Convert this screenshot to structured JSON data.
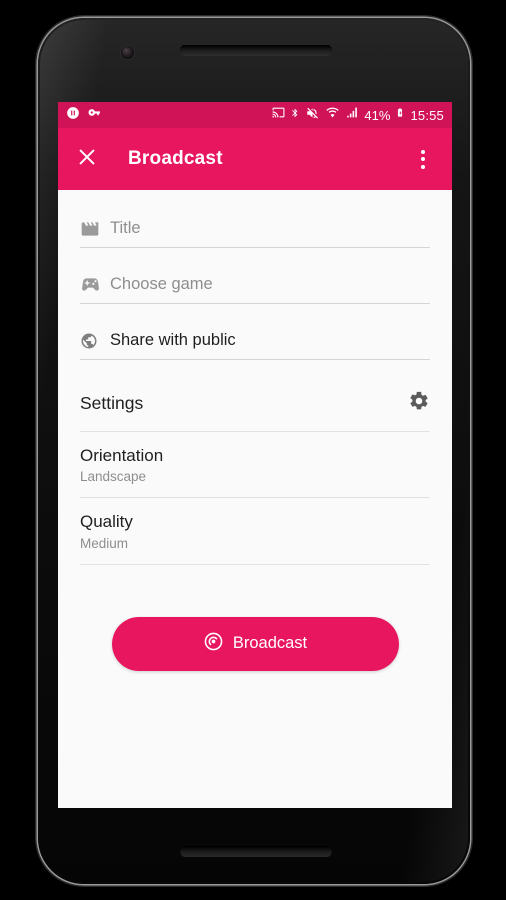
{
  "device": {
    "frame": "android-phone-mockup",
    "camera": "front-camera",
    "earpiece": "earpiece-speaker",
    "bottom_speaker": "bottom-speaker",
    "power_button": "power-button",
    "volume_button": "volume-button"
  },
  "statusbar": {
    "background": "#D01257",
    "left_icons": [
      {
        "name": "pause-icon",
        "glyph": "pause"
      },
      {
        "name": "vpn-key-icon",
        "glyph": "key"
      }
    ],
    "right_icons": [
      {
        "name": "cast-icon",
        "glyph": "cast"
      },
      {
        "name": "bluetooth-icon",
        "glyph": "bluetooth"
      },
      {
        "name": "volume-off-vibrate-icon",
        "glyph": "mute"
      },
      {
        "name": "wifi-icon",
        "glyph": "wifi"
      },
      {
        "name": "cellular-signal-icon",
        "glyph": "signal"
      }
    ],
    "battery_percent": "41%",
    "battery_icon": "battery-charging-icon",
    "clock": "15:55"
  },
  "appbar": {
    "background": "#E8165F",
    "close_icon": "close-icon",
    "title": "Broadcast",
    "overflow_icon": "more-vert-icon"
  },
  "form": {
    "fields": [
      {
        "name": "title-field",
        "icon": "movie-clapper-icon",
        "text": "Title",
        "is_placeholder": true
      },
      {
        "name": "choose-game-field",
        "icon": "gamepad-icon",
        "text": "Choose game",
        "is_placeholder": true
      },
      {
        "name": "privacy-field",
        "icon": "globe-public-icon",
        "text": "Share with public",
        "is_placeholder": false
      }
    ]
  },
  "settings": {
    "header": "Settings",
    "gear_icon": "gear-icon",
    "rows": [
      {
        "name": "orientation-row",
        "title": "Orientation",
        "value": "Landscape"
      },
      {
        "name": "quality-row",
        "title": "Quality",
        "value": "Medium"
      }
    ]
  },
  "cta": {
    "label": "Broadcast",
    "icon": "broadcast-icon",
    "background": "#E8165F"
  },
  "colors": {
    "accent": "#E8165F",
    "statusbar": "#D01257",
    "page_bg": "#FAFAFA",
    "divider": "#E2E2E2",
    "muted_text": "#8E8E8E",
    "primary_text": "#1F1F1F"
  }
}
